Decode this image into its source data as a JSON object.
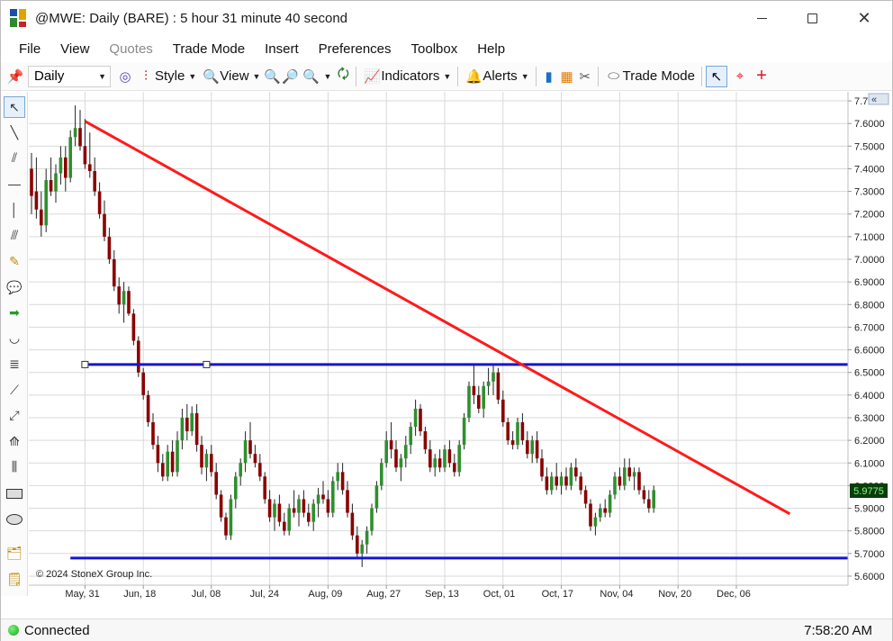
{
  "window": {
    "title": "@MWE: Daily (BARE) : 5 hour 31 minute 40 second",
    "controls": [
      "minimize",
      "maximize",
      "close"
    ]
  },
  "menu": [
    {
      "label": "File",
      "disabled": false
    },
    {
      "label": "View",
      "disabled": false
    },
    {
      "label": "Quotes",
      "disabled": true
    },
    {
      "label": "Trade Mode",
      "disabled": false
    },
    {
      "label": "Insert",
      "disabled": false
    },
    {
      "label": "Preferences",
      "disabled": false
    },
    {
      "label": "Toolbox",
      "disabled": false
    },
    {
      "label": "Help",
      "disabled": false
    }
  ],
  "toolbar": {
    "interval": "Daily",
    "style_label": "Style",
    "view_label": "View",
    "indicators_label": "Indicators",
    "alerts_label": "Alerts",
    "trade_mode_label": "Trade Mode"
  },
  "status": {
    "connection": "Connected",
    "time": "7:58:20 AM"
  },
  "colors": {
    "up_candle": "#2f8f2f",
    "down_candle": "#8b0000",
    "wick": "#222222",
    "trendline": "#ff1a1a",
    "hline": "#1515d4",
    "last_price_bg": "#0b3d0b",
    "last_price_fg": "#7dff7d",
    "grid": "#d9d9d9"
  },
  "chart_data": {
    "type": "candlestick",
    "symbol": "@MWE",
    "interval": "Daily",
    "copyright": "© 2024 StoneX Group Inc.",
    "last_price": "5.9775",
    "ylim": [
      5.56,
      7.74
    ],
    "y_ticks": [
      "7.7000",
      "7.6000",
      "7.5000",
      "7.4000",
      "7.3000",
      "7.2000",
      "7.1000",
      "7.0000",
      "6.9000",
      "6.8000",
      "6.7000",
      "6.6000",
      "6.5000",
      "6.4000",
      "6.3000",
      "6.2000",
      "6.1000",
      "6.0000",
      "5.9000",
      "5.8000",
      "5.7000",
      "5.6000"
    ],
    "x_ticks": [
      {
        "label": "May, 31",
        "bar": 11
      },
      {
        "label": "Jun, 18",
        "bar": 23
      },
      {
        "label": "Jul, 08",
        "bar": 37
      },
      {
        "label": "Jul, 24",
        "bar": 49
      },
      {
        "label": "Aug, 09",
        "bar": 61
      },
      {
        "label": "Aug, 27",
        "bar": 73
      },
      {
        "label": "Sep, 13",
        "bar": 85
      },
      {
        "label": "Oct, 01",
        "bar": 97
      },
      {
        "label": "Oct, 17",
        "bar": 109
      },
      {
        "label": "Nov, 04",
        "bar": 121
      },
      {
        "label": "Nov, 20",
        "bar": 133
      },
      {
        "label": "Dec, 06",
        "bar": 145
      }
    ],
    "bars_total": 157,
    "candles": [
      [
        7.4,
        7.47,
        7.2,
        7.28
      ],
      [
        7.3,
        7.45,
        7.18,
        7.22
      ],
      [
        7.22,
        7.3,
        7.1,
        7.15
      ],
      [
        7.15,
        7.4,
        7.12,
        7.35
      ],
      [
        7.35,
        7.45,
        7.28,
        7.3
      ],
      [
        7.3,
        7.42,
        7.25,
        7.38
      ],
      [
        7.38,
        7.5,
        7.33,
        7.45
      ],
      [
        7.45,
        7.5,
        7.3,
        7.36
      ],
      [
        7.36,
        7.57,
        7.34,
        7.54
      ],
      [
        7.54,
        7.68,
        7.5,
        7.58
      ],
      [
        7.58,
        7.66,
        7.48,
        7.5
      ],
      [
        7.5,
        7.62,
        7.4,
        7.42
      ],
      [
        7.42,
        7.56,
        7.36,
        7.39
      ],
      [
        7.39,
        7.45,
        7.28,
        7.3
      ],
      [
        7.3,
        7.34,
        7.18,
        7.2
      ],
      [
        7.2,
        7.26,
        7.08,
        7.1
      ],
      [
        7.1,
        7.14,
        6.98,
        7.0
      ],
      [
        7.0,
        7.04,
        6.86,
        6.88
      ],
      [
        6.88,
        6.92,
        6.76,
        6.8
      ],
      [
        6.8,
        6.9,
        6.72,
        6.86
      ],
      [
        6.86,
        6.88,
        6.75,
        6.76
      ],
      [
        6.76,
        6.78,
        6.62,
        6.64
      ],
      [
        6.64,
        6.66,
        6.48,
        6.5
      ],
      [
        6.5,
        6.52,
        6.38,
        6.4
      ],
      [
        6.4,
        6.42,
        6.26,
        6.28
      ],
      [
        6.28,
        6.32,
        6.16,
        6.18
      ],
      [
        6.18,
        6.22,
        6.06,
        6.1
      ],
      [
        6.1,
        6.14,
        6.02,
        6.04
      ],
      [
        6.04,
        6.18,
        6.02,
        6.15
      ],
      [
        6.15,
        6.2,
        6.04,
        6.06
      ],
      [
        6.06,
        6.24,
        6.04,
        6.2
      ],
      [
        6.2,
        6.34,
        6.16,
        6.3
      ],
      [
        6.3,
        6.36,
        6.2,
        6.24
      ],
      [
        6.24,
        6.35,
        6.22,
        6.32
      ],
      [
        6.32,
        6.36,
        6.15,
        6.18
      ],
      [
        6.18,
        6.22,
        6.05,
        6.08
      ],
      [
        6.08,
        6.16,
        6.02,
        6.14
      ],
      [
        6.14,
        6.18,
        6.04,
        6.06
      ],
      [
        6.06,
        6.1,
        5.94,
        5.96
      ],
      [
        5.96,
        5.98,
        5.84,
        5.86
      ],
      [
        5.86,
        5.88,
        5.76,
        5.78
      ],
      [
        5.78,
        5.96,
        5.76,
        5.94
      ],
      [
        5.94,
        6.06,
        5.9,
        6.04
      ],
      [
        6.04,
        6.12,
        6.0,
        6.1
      ],
      [
        6.1,
        6.24,
        6.06,
        6.2
      ],
      [
        6.2,
        6.28,
        6.12,
        6.14
      ],
      [
        6.14,
        6.18,
        6.08,
        6.1
      ],
      [
        6.1,
        6.14,
        6.02,
        6.04
      ],
      [
        6.04,
        6.06,
        5.92,
        5.94
      ],
      [
        5.94,
        5.98,
        5.84,
        5.86
      ],
      [
        5.86,
        5.94,
        5.8,
        5.92
      ],
      [
        5.92,
        5.96,
        5.82,
        5.84
      ],
      [
        5.84,
        5.88,
        5.78,
        5.8
      ],
      [
        5.8,
        5.92,
        5.78,
        5.9
      ],
      [
        5.9,
        5.98,
        5.86,
        5.88
      ],
      [
        5.88,
        5.96,
        5.82,
        5.94
      ],
      [
        5.94,
        5.98,
        5.86,
        5.88
      ],
      [
        5.88,
        5.92,
        5.82,
        5.84
      ],
      [
        5.84,
        5.94,
        5.8,
        5.92
      ],
      [
        5.92,
        5.99,
        5.86,
        5.96
      ],
      [
        5.96,
        6.02,
        5.92,
        5.94
      ],
      [
        5.94,
        5.98,
        5.86,
        5.88
      ],
      [
        5.88,
        6.04,
        5.86,
        6.02
      ],
      [
        6.02,
        6.1,
        5.98,
        6.06
      ],
      [
        6.06,
        6.1,
        5.96,
        5.98
      ],
      [
        5.98,
        6.02,
        5.86,
        5.88
      ],
      [
        5.88,
        5.92,
        5.76,
        5.78
      ],
      [
        5.78,
        5.82,
        5.68,
        5.7
      ],
      [
        5.7,
        5.76,
        5.64,
        5.74
      ],
      [
        5.74,
        5.82,
        5.7,
        5.8
      ],
      [
        5.8,
        5.92,
        5.78,
        5.9
      ],
      [
        5.9,
        6.02,
        5.88,
        6.0
      ],
      [
        6.0,
        6.12,
        5.98,
        6.1
      ],
      [
        6.1,
        6.24,
        6.08,
        6.2
      ],
      [
        6.2,
        6.28,
        6.12,
        6.16
      ],
      [
        6.16,
        6.2,
        6.06,
        6.08
      ],
      [
        6.08,
        6.14,
        6.02,
        6.12
      ],
      [
        6.12,
        6.22,
        6.08,
        6.18
      ],
      [
        6.18,
        6.28,
        6.14,
        6.26
      ],
      [
        6.26,
        6.38,
        6.22,
        6.34
      ],
      [
        6.34,
        6.36,
        6.22,
        6.24
      ],
      [
        6.24,
        6.26,
        6.14,
        6.16
      ],
      [
        6.16,
        6.2,
        6.06,
        6.08
      ],
      [
        6.08,
        6.14,
        6.04,
        6.12
      ],
      [
        6.12,
        6.16,
        6.06,
        6.08
      ],
      [
        6.08,
        6.18,
        6.06,
        6.16
      ],
      [
        6.16,
        6.2,
        6.08,
        6.1
      ],
      [
        6.1,
        6.14,
        6.04,
        6.06
      ],
      [
        6.06,
        6.2,
        6.04,
        6.18
      ],
      [
        6.18,
        6.32,
        6.16,
        6.3
      ],
      [
        6.3,
        6.46,
        6.28,
        6.44
      ],
      [
        6.44,
        6.54,
        6.36,
        6.4
      ],
      [
        6.4,
        6.44,
        6.32,
        6.34
      ],
      [
        6.34,
        6.46,
        6.3,
        6.44
      ],
      [
        6.44,
        6.52,
        6.4,
        6.46
      ],
      [
        6.46,
        6.54,
        6.4,
        6.5
      ],
      [
        6.5,
        6.52,
        6.36,
        6.38
      ],
      [
        6.38,
        6.42,
        6.26,
        6.28
      ],
      [
        6.28,
        6.3,
        6.18,
        6.2
      ],
      [
        6.2,
        6.24,
        6.16,
        6.18
      ],
      [
        6.18,
        6.3,
        6.16,
        6.28
      ],
      [
        6.28,
        6.32,
        6.18,
        6.2
      ],
      [
        6.2,
        6.24,
        6.12,
        6.14
      ],
      [
        6.14,
        6.22,
        6.1,
        6.2
      ],
      [
        6.2,
        6.24,
        6.1,
        6.12
      ],
      [
        6.12,
        6.16,
        6.02,
        6.04
      ],
      [
        6.04,
        6.08,
        5.96,
        5.98
      ],
      [
        5.98,
        6.06,
        5.96,
        6.04
      ],
      [
        6.04,
        6.1,
        5.98,
        6.0
      ],
      [
        6.0,
        6.06,
        5.96,
        6.04
      ],
      [
        6.04,
        6.08,
        5.98,
        6.0
      ],
      [
        6.0,
        6.1,
        5.98,
        6.08
      ],
      [
        6.08,
        6.12,
        6.02,
        6.04
      ],
      [
        6.04,
        6.06,
        5.96,
        5.98
      ],
      [
        5.98,
        6.0,
        5.9,
        5.92
      ],
      [
        5.92,
        5.94,
        5.8,
        5.82
      ],
      [
        5.82,
        5.88,
        5.78,
        5.86
      ],
      [
        5.86,
        5.92,
        5.84,
        5.9
      ],
      [
        5.9,
        5.94,
        5.86,
        5.88
      ],
      [
        5.88,
        5.98,
        5.86,
        5.96
      ],
      [
        5.96,
        6.06,
        5.94,
        6.04
      ],
      [
        6.04,
        6.08,
        5.98,
        6.0
      ],
      [
        6.0,
        6.12,
        5.98,
        6.08
      ],
      [
        6.08,
        6.12,
        6.02,
        6.04
      ],
      [
        6.04,
        6.08,
        5.98,
        6.06
      ],
      [
        6.06,
        6.08,
        5.96,
        5.98
      ],
      [
        5.98,
        6.0,
        5.92,
        5.94
      ],
      [
        5.94,
        5.98,
        5.88,
        5.9
      ],
      [
        5.9,
        6.0,
        5.88,
        5.98
      ]
    ],
    "trendline": {
      "start": {
        "bar": 11,
        "price": 7.61
      },
      "end": {
        "bar": 156,
        "price": 5.875
      },
      "color": "red"
    },
    "horizontal_lines": [
      {
        "price": 6.535,
        "from_bar": 11,
        "color": "blue",
        "handles": [
          11,
          36
        ]
      },
      {
        "price": 5.68,
        "from_bar": 8,
        "color": "blue"
      }
    ]
  }
}
